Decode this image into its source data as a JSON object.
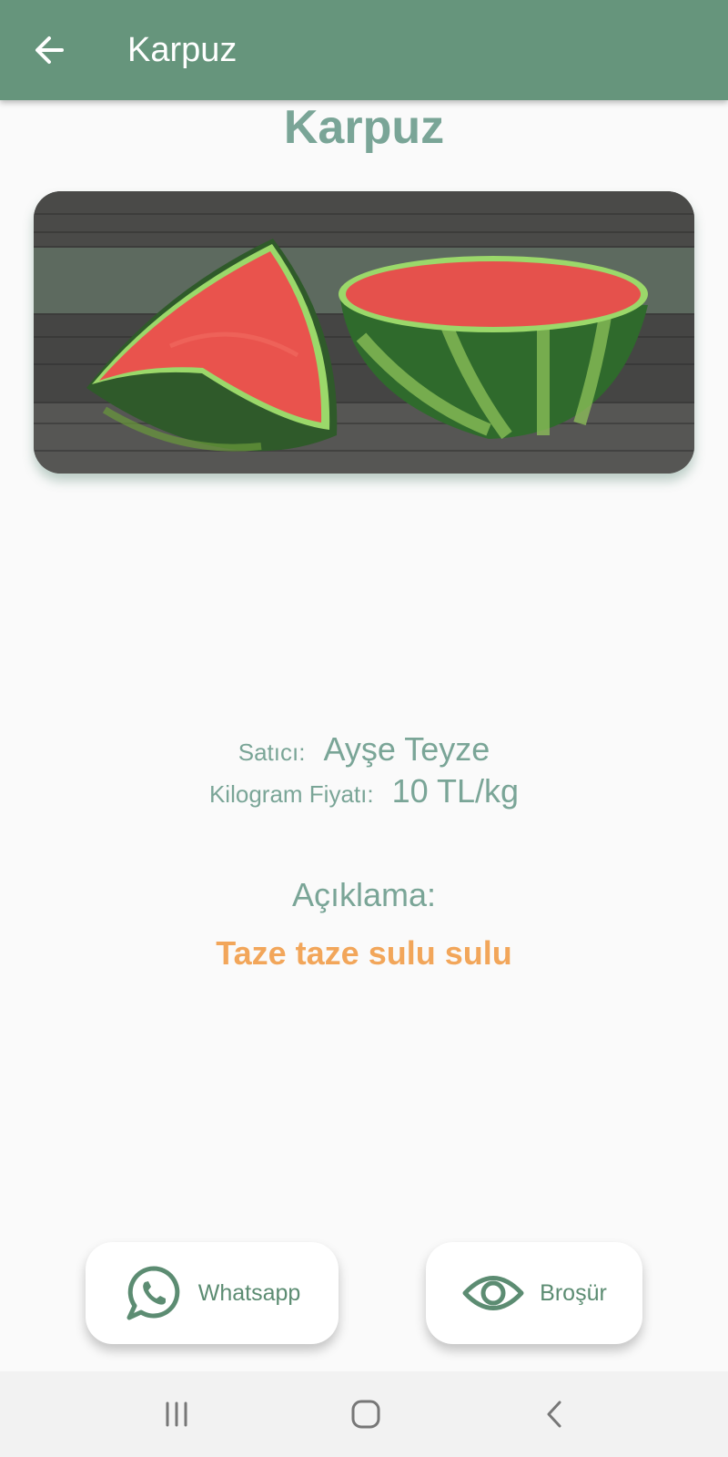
{
  "colors": {
    "primary": "#66957c",
    "title": "#7aa597",
    "accent": "#f2a65a",
    "icon": "#5c8c72"
  },
  "app_bar": {
    "back_icon": "arrow-left-icon",
    "title": "Karpuz"
  },
  "product": {
    "name": "Karpuz",
    "image": "watermelon-photo",
    "seller_label": "Satıcı:",
    "seller": "Ayşe Teyze",
    "price_label": "Kilogram Fiyatı:",
    "price": "10 TL/kg",
    "description_label": "Açıklama:",
    "description": "Taze taze sulu sulu"
  },
  "actions": {
    "whatsapp": {
      "label": "Whatsapp",
      "icon": "whatsapp-icon"
    },
    "brochure": {
      "label": "Broşür",
      "icon": "eye-icon"
    }
  },
  "nav": {
    "recent_icon": "recent-apps-icon",
    "home_icon": "home-icon",
    "back_icon": "back-chevron-icon"
  }
}
